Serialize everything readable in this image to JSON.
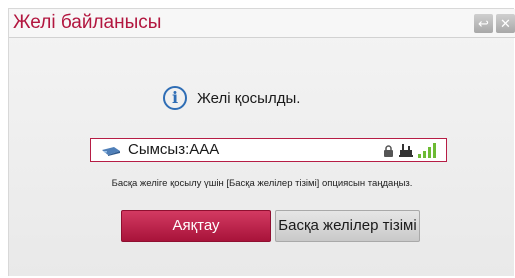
{
  "window": {
    "title": "Желі байланысы",
    "back_icon": "back-arrow-icon",
    "close_icon": "close-icon"
  },
  "status": {
    "icon": "info-icon",
    "info_glyph": "i",
    "text": "Желі қосылды."
  },
  "network": {
    "type_icon": "wireless-network-icon",
    "name": "Сымсыз:AAA",
    "lock_icon": "lock-icon",
    "wired_icon": "wired-connection-icon",
    "signal_icon": "signal-strength-icon",
    "signal_color": "#6dbb34"
  },
  "hint": "Басқа желіге қосылу үшін [Басқа желілер тізімі] опциясын таңдаңыз.",
  "buttons": {
    "finish": "Аяқтау",
    "other_networks": "Басқа желілер тізімі"
  },
  "colors": {
    "accent": "#b2163f",
    "primary_button": "#c0204a",
    "info_blue": "#2e6db5"
  }
}
